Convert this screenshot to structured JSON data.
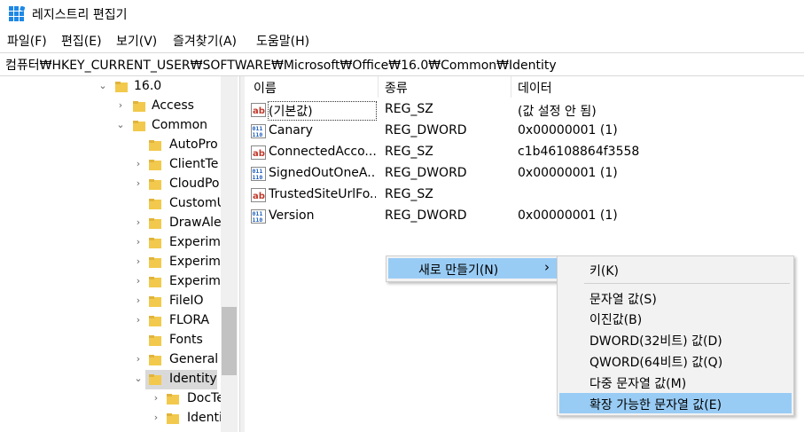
{
  "window": {
    "title": "레지스트리 편집기"
  },
  "menu": [
    "파일(F)",
    "편집(E)",
    "보기(V)",
    "즐겨찾기(A)",
    "도움말(H)"
  ],
  "address": "컴퓨터₩HKEY_CURRENT_USER₩SOFTWARE₩Microsoft₩Office₩16.0₩Common₩Identity",
  "tree": [
    {
      "label": "16.0",
      "state": "expanded"
    },
    {
      "label": "Access",
      "state": "collapsed"
    },
    {
      "label": "Common",
      "state": "expanded"
    },
    {
      "label": "AutoPro",
      "state": "none"
    },
    {
      "label": "ClientTe",
      "state": "collapsed"
    },
    {
      "label": "CloudPo",
      "state": "collapsed"
    },
    {
      "label": "CustomU",
      "state": "none"
    },
    {
      "label": "DrawAle",
      "state": "collapsed"
    },
    {
      "label": "Experime",
      "state": "collapsed"
    },
    {
      "label": "Experime",
      "state": "collapsed"
    },
    {
      "label": "Experime",
      "state": "collapsed"
    },
    {
      "label": "FileIO",
      "state": "collapsed"
    },
    {
      "label": "FLORA",
      "state": "collapsed"
    },
    {
      "label": "Fonts",
      "state": "none"
    },
    {
      "label": "General",
      "state": "collapsed"
    },
    {
      "label": "Identity",
      "state": "expanded",
      "selected": true
    },
    {
      "label": "DocTe",
      "state": "collapsed"
    },
    {
      "label": "Identi",
      "state": "collapsed"
    }
  ],
  "columns": [
    "이름",
    "종류",
    "데이터"
  ],
  "values": [
    {
      "name": "(기본값)",
      "type": "REG_SZ",
      "data": "(값 설정 안 됨)",
      "icon": "string-value-icon"
    },
    {
      "name": "Canary",
      "type": "REG_DWORD",
      "data": "0x00000001 (1)",
      "icon": "binary-value-icon"
    },
    {
      "name": "ConnectedAcco...",
      "type": "REG_SZ",
      "data": "c1b46108864f3558",
      "icon": "string-value-icon"
    },
    {
      "name": "SignedOutOneA...",
      "type": "REG_DWORD",
      "data": "0x00000001 (1)",
      "icon": "binary-value-icon"
    },
    {
      "name": "TrustedSiteUrlFo...",
      "type": "REG_SZ",
      "data": "",
      "icon": "string-value-icon"
    },
    {
      "name": "Version",
      "type": "REG_DWORD",
      "data": "0x00000001 (1)",
      "icon": "binary-value-icon"
    }
  ],
  "context_menu": {
    "new_label": "새로 만들기(N)",
    "arrow": "›"
  },
  "submenu": {
    "key": "키(K)",
    "items": [
      "문자열 값(S)",
      "이진값(B)",
      "DWORD(32비트) 값(D)",
      "QWORD(64비트) 값(Q)",
      "다중 문자열 값(M)",
      "확장 가능한 문자열 값(E)"
    ],
    "highlighted": "확장 가능한 문자열 값(E)"
  }
}
